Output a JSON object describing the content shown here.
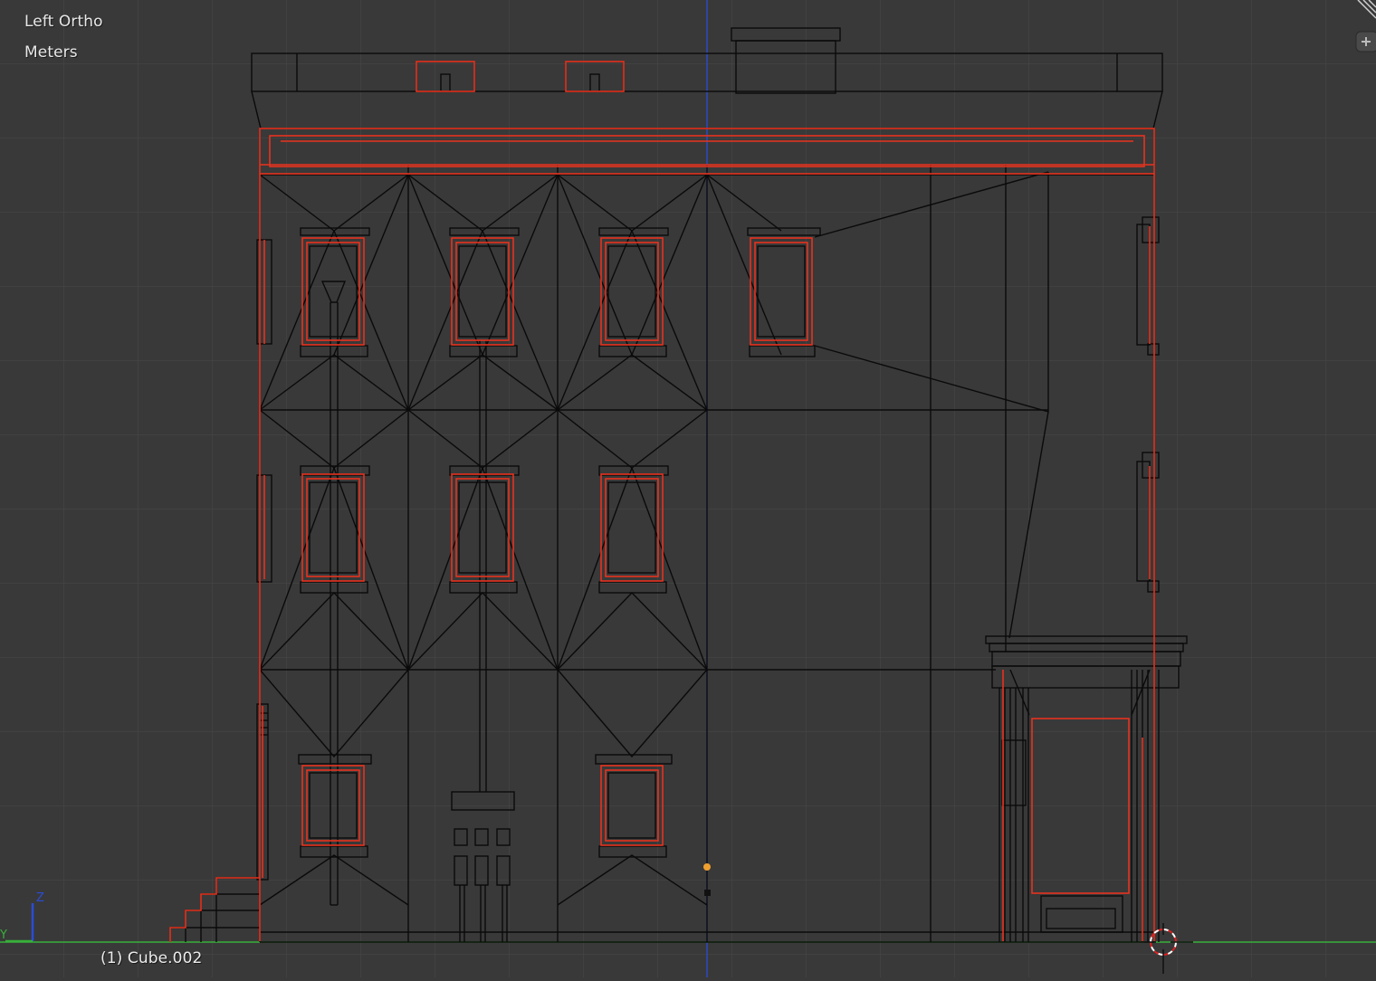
{
  "viewport": {
    "view_name": "Left Ortho",
    "units": "Meters",
    "active_object": "(1) Cube.002",
    "axis_labels": {
      "z": "Z",
      "y": "Y"
    },
    "colors": {
      "background": "#393939",
      "grid": "#444444",
      "wire": "#0a0a0a",
      "selected_wire": "#e8321e",
      "z_axis": "#2a4cd6",
      "y_axis": "#38b03a",
      "origin": "#f0a030"
    },
    "icons": [
      "split-area-icon",
      "view-properties-plus-icon",
      "3d-cursor-icon"
    ]
  }
}
